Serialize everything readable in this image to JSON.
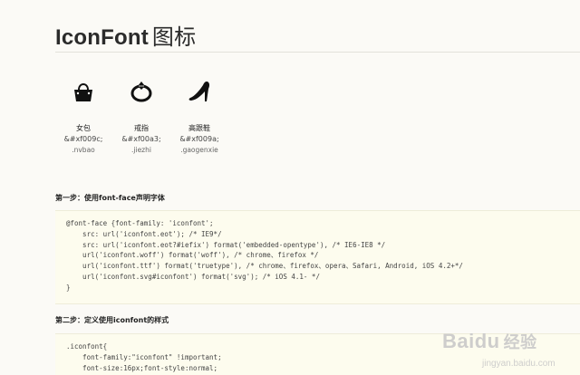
{
  "page": {
    "title_latin": "IconFont",
    "title_cjk": "图标"
  },
  "icons": [
    {
      "name": "女包",
      "code": "&#xf009c;",
      "class": ".nvbao",
      "icon": "handbag-icon"
    },
    {
      "name": "戒指",
      "code": "&#xf00a3;",
      "class": ".jiezhi",
      "icon": "ring-icon"
    },
    {
      "name": "高跟鞋",
      "code": "&#xf009a;",
      "class": ".gaogenxie",
      "icon": "high-heel-icon"
    }
  ],
  "steps": [
    {
      "title": "第一步：使用font-face声明字体",
      "code": [
        "@font-face {font-family: 'iconfont';",
        "    src: url('iconfont.eot'); /* IE9*/",
        "    src: url('iconfont.eot?#iefix') format('embedded-opentype'), /* IE6-IE8 */",
        "    url('iconfont.woff') format('woff'), /* chrome、firefox */",
        "    url('iconfont.ttf') format('truetype'), /* chrome、firefox、opera、Safari, Android, iOS 4.2+*/",
        "    url('iconfont.svg#iconfont') format('svg'); /* iOS 4.1- */",
        "}"
      ]
    },
    {
      "title": "第二步：定义使用iconfont的样式",
      "code": [
        ".iconfont{",
        "    font-family:\"iconfont\" !important;",
        "    font-size:16px;font-style:normal;"
      ]
    }
  ],
  "watermark": {
    "brand": "Baidu",
    "brand_cn": "经验",
    "url": "jingyan.baidu.com"
  }
}
